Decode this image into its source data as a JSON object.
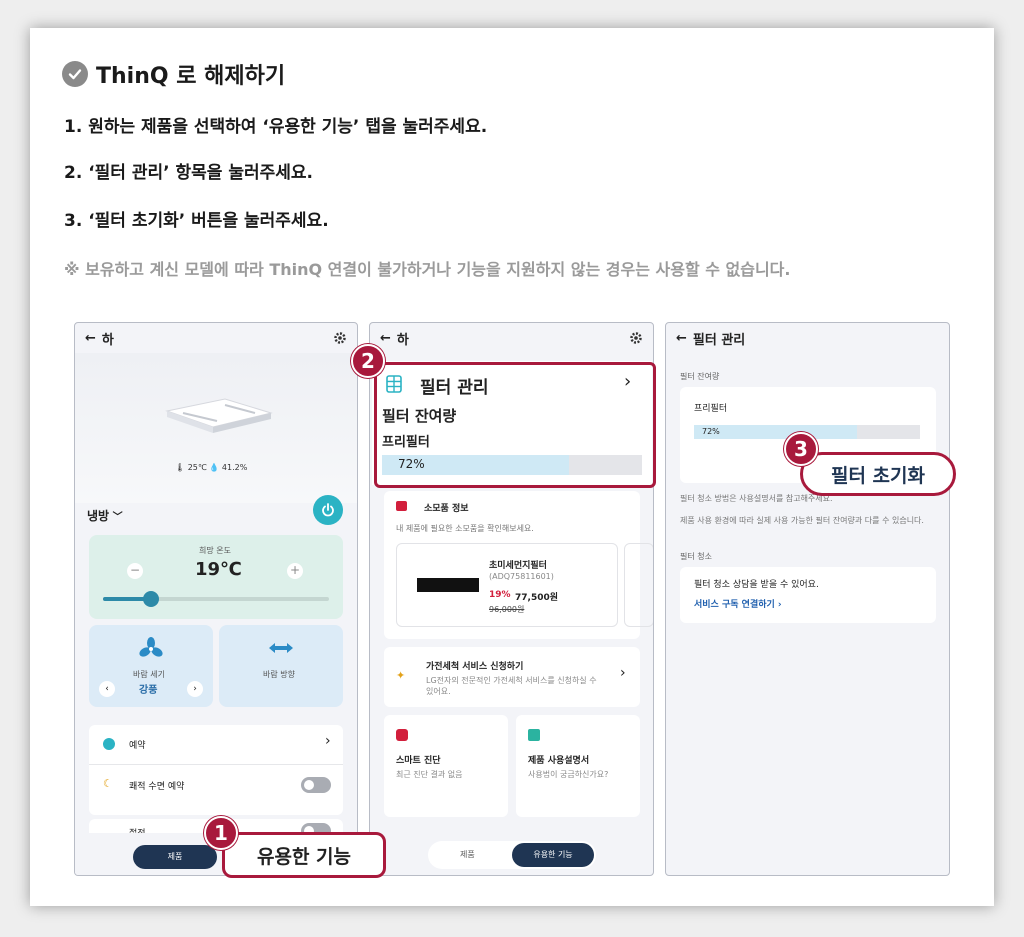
{
  "heading": {
    "title": "ThinQ 로 해제하기"
  },
  "steps": [
    "1. 원하는 제품을 선택하여 ‘유용한 기능’ 탭을 눌러주세요.",
    "2. ‘필터 관리’ 항목을 눌러주세요.",
    "3. ‘필터 초기화’ 버튼을 눌러주세요."
  ],
  "note": "※ 보유하고 계신 모델에 따라 ThinQ 연결이 불가하거나 기능을 지원하지 않는 경우는 사용할 수 없습니다.",
  "screen1": {
    "title": "하",
    "env": "🌡 25℃  💧 41.2%",
    "mode": "냉방",
    "temp_label": "희망 온도",
    "temp_value": "19℃",
    "wind_strength_label": "바람 세기",
    "wind_strength_value": "강풍",
    "wind_direction_label": "바람 방향",
    "reservation": "예약",
    "sleep_reservation": "쾌적 수면 예약",
    "power_save": "절전",
    "tab_product": "제품",
    "callout_label": "유용한 기능"
  },
  "screen2": {
    "title": "하",
    "filter_title": "필터 관리",
    "filter_remaining": "필터 잔여량",
    "prefilter": "프리필터",
    "percent": "72%",
    "progress": 0.72,
    "consumables_title": "소모품 정보",
    "consumables_desc": "내 제품에 필요한 소모품을 확인해보세요.",
    "product_name": "초미세먼지필터",
    "product_code": "(ADQ75811601)",
    "discount": "19%",
    "price": "77,500원",
    "original_price": "96,000원",
    "service_title": "가전세척 서비스 신청하기",
    "service_desc": "LG전자의 전문적인 가전세척 서비스를 신청하실 수 있어요.",
    "smart_title": "스마트 진단",
    "smart_desc": "최근 진단 결과 없음",
    "manual_title": "제품 사용설명서",
    "manual_desc": "사용법이 궁금하신가요?",
    "tab_product": "제품",
    "tab_useful": "유용한 기능"
  },
  "screen3": {
    "title": "필터 관리",
    "section_remaining": "필터 잔여량",
    "prefilter": "프리필터",
    "percent": "72%",
    "progress": 0.72,
    "info1": "필터 청소 방법은 사용설명서를 참고해주세요.",
    "info2": "제품 사용 환경에 따라 실제 사용 가능한 필터 잔여량과 다를 수 있습니다.",
    "section_clean": "필터 청소",
    "clean_desc": "필터 청소 상담을 받을 수 있어요.",
    "clean_link": "서비스 구독 연결하기",
    "callout_label": "필터 초기화"
  },
  "badges": [
    "1",
    "2",
    "3"
  ],
  "colors": {
    "accent_red": "#a8193c",
    "progress_fill": "#cfe9f5",
    "power_teal": "#2bb3c4"
  }
}
